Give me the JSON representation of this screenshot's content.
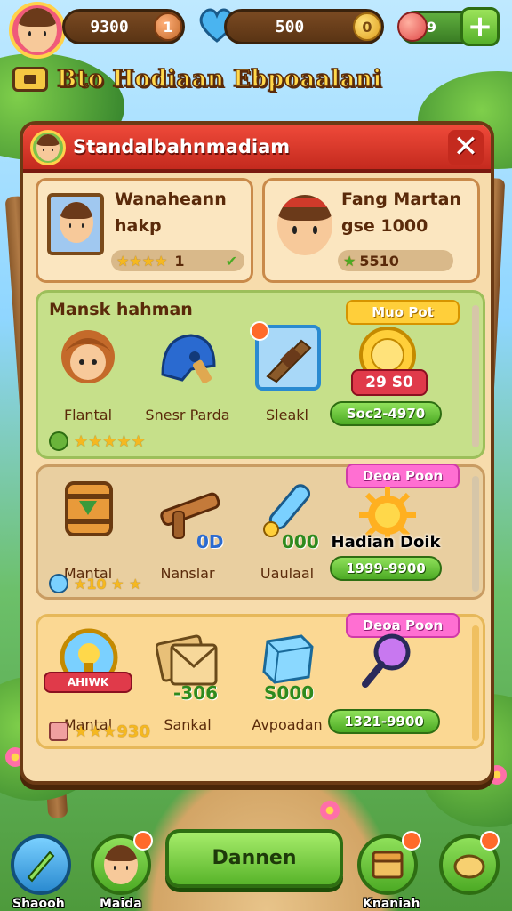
{
  "hud": {
    "coins": "9300",
    "coin_symbol": "1",
    "hearts": "500",
    "heart_symbol": "0",
    "gems": "9",
    "add_symbol": "+"
  },
  "banner": {
    "title": "Bto Hodiaan Ebpoaalani"
  },
  "panel": {
    "title": "Standalbahnmadiam",
    "close_symbol": "✕"
  },
  "profiles": [
    {
      "name": "Wanaheann",
      "sub": "hakp",
      "stars": "★★★★",
      "bar_text": "1"
    },
    {
      "name": "Fang Martan",
      "sub": "gse 1000",
      "stars": "★",
      "bar_text": "5510"
    }
  ],
  "section1": {
    "title": "Mansk hahman",
    "tag": "Muo Pot",
    "price_label": "29 S0",
    "price": "Soc2-4970",
    "stars": "★★★★★",
    "items": [
      {
        "label": "Flantal",
        "icon": "warrior-portrait-icon"
      },
      {
        "label": "Snesr Parda",
        "icon": "blue-helmet-icon"
      },
      {
        "label": "Sleakl",
        "icon": "wooden-club-icon",
        "badge": "0"
      },
      {
        "label": "",
        "icon": "gold-coin-icon"
      }
    ]
  },
  "section2": {
    "tag": "Deoa Poon",
    "highlight": "Hadian Doik",
    "price": "1999-9900",
    "stars": "★10 ★ ★",
    "items": [
      {
        "label": "Mantal",
        "icon": "barrel-icon"
      },
      {
        "label": "Nanslar",
        "icon": "wooden-crossbow-icon",
        "overlay": "0D"
      },
      {
        "label": "Uaulaal",
        "icon": "blue-sword-icon",
        "overlay": "000"
      },
      {
        "label": "",
        "icon": "sun-medal-icon"
      }
    ]
  },
  "section3": {
    "tag": "Deoa Poon",
    "price": "1321-9900",
    "stars": "★★★930",
    "items": [
      {
        "label": "Mantal",
        "icon": "lightbulb-emblem-icon",
        "ribbon": "AHIWK"
      },
      {
        "label": "Sankal",
        "icon": "envelope-stack-icon",
        "overlay": "-306"
      },
      {
        "label": "Avpoadan",
        "icon": "ice-cube-icon",
        "overlay": "S000"
      },
      {
        "label": "",
        "icon": "magnifier-icon"
      }
    ]
  },
  "bottom_nav": {
    "left1": "Shaooh",
    "left2": "Maida",
    "main_button": "Dannen",
    "right1": "Knaniah"
  }
}
